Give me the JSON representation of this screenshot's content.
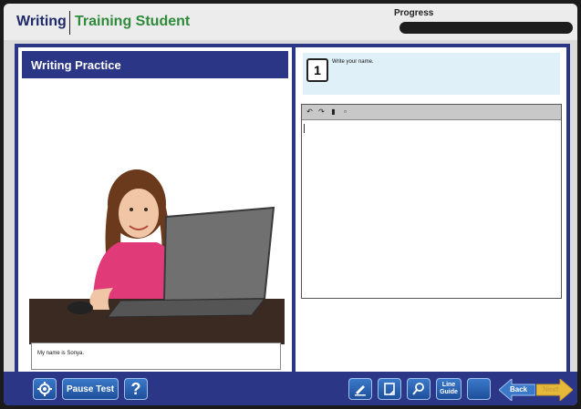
{
  "header": {
    "app_name": "Writing",
    "user_name": "Training Student",
    "progress_label": "Progress",
    "progress_value": 0
  },
  "left_panel": {
    "title": "Writing Practice",
    "image_caption": "My name is Sonya."
  },
  "question": {
    "number": "1",
    "text": "Write your name."
  },
  "editor": {
    "toolbar_icons": [
      "undo-icon",
      "redo-icon",
      "paste-icon",
      "copy-icon"
    ],
    "value": ""
  },
  "footer": {
    "pause_label": "Pause Test",
    "help_label": "?",
    "line_guide_label_1": "Line",
    "line_guide_label_2": "Guide",
    "back_label": "Back",
    "next_label": "Next"
  },
  "colors": {
    "brand_navy": "#2b3686",
    "brand_green": "#2e8b3a",
    "question_bg": "#dff0f8",
    "next_gold": "#e7b93b",
    "back_blue": "#3a79c9"
  }
}
